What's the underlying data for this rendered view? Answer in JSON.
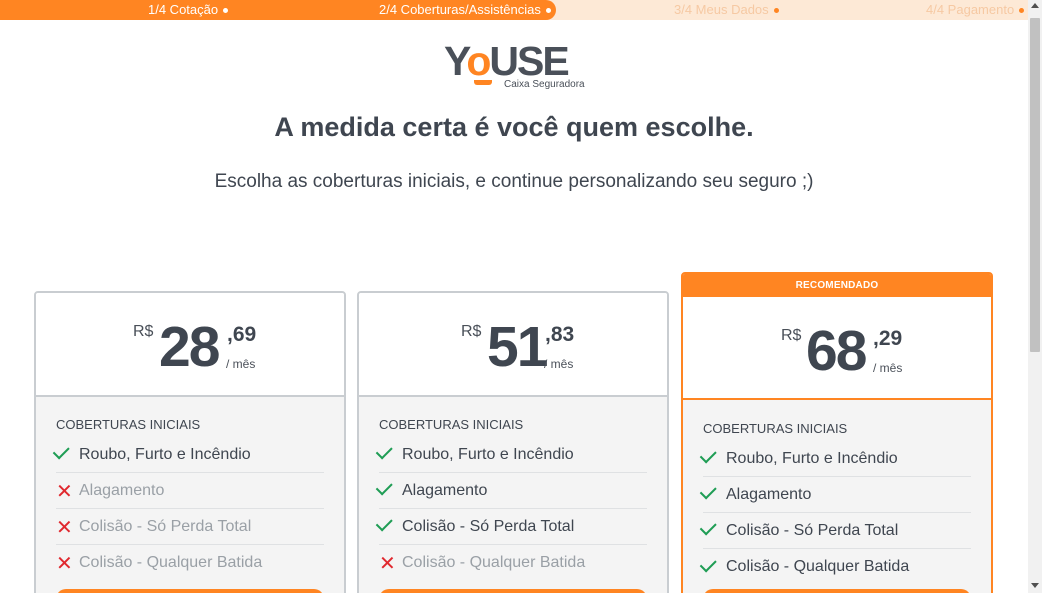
{
  "progress": {
    "steps": [
      {
        "label": "1/4 Cotação"
      },
      {
        "label": "2/4 Coberturas/Assistências"
      },
      {
        "label": "3/4 Meus Dados"
      },
      {
        "label": "4/4 Pagamento"
      }
    ],
    "completed_fraction": 0.5
  },
  "brand": {
    "logo_word_before": "Y",
    "logo_o": "o",
    "logo_word_after": "USE",
    "logo_sub": "Caixa Seguradora",
    "accent": "#ff8522",
    "text_color": "#3f4650"
  },
  "headline": "A medida certa é você quem escolhe.",
  "subtitle": "Escolha as coberturas iniciais, e continue personalizando seu seguro ;)",
  "plans": [
    {
      "currency": "R$",
      "amount": "28",
      "cents": ",69",
      "period": "/ mês",
      "coverage_title": "COBERTURAS INICIAIS",
      "coverages": [
        {
          "label": "Roubo, Furto e Incêndio",
          "included": true
        },
        {
          "label": "Alagamento",
          "included": false
        },
        {
          "label": "Colisão - Só Perda Total",
          "included": false
        },
        {
          "label": "Colisão - Qualquer Batida",
          "included": false
        }
      ]
    },
    {
      "currency": "R$",
      "amount": "51",
      "cents": ",83",
      "period": "/ mês",
      "coverage_title": "COBERTURAS INICIAIS",
      "coverages": [
        {
          "label": "Roubo, Furto e Incêndio",
          "included": true
        },
        {
          "label": "Alagamento",
          "included": true
        },
        {
          "label": "Colisão - Só Perda Total",
          "included": true
        },
        {
          "label": "Colisão - Qualquer Batida",
          "included": false
        }
      ]
    },
    {
      "badge": "RECOMENDADO",
      "currency": "R$",
      "amount": "68",
      "cents": ",29",
      "period": "/ mês",
      "coverage_title": "COBERTURAS INICIAIS",
      "coverages": [
        {
          "label": "Roubo, Furto e Incêndio",
          "included": true
        },
        {
          "label": "Alagamento",
          "included": true
        },
        {
          "label": "Colisão - Só Perda Total",
          "included": true
        },
        {
          "label": "Colisão - Qualquer Batida",
          "included": true
        }
      ]
    }
  ]
}
